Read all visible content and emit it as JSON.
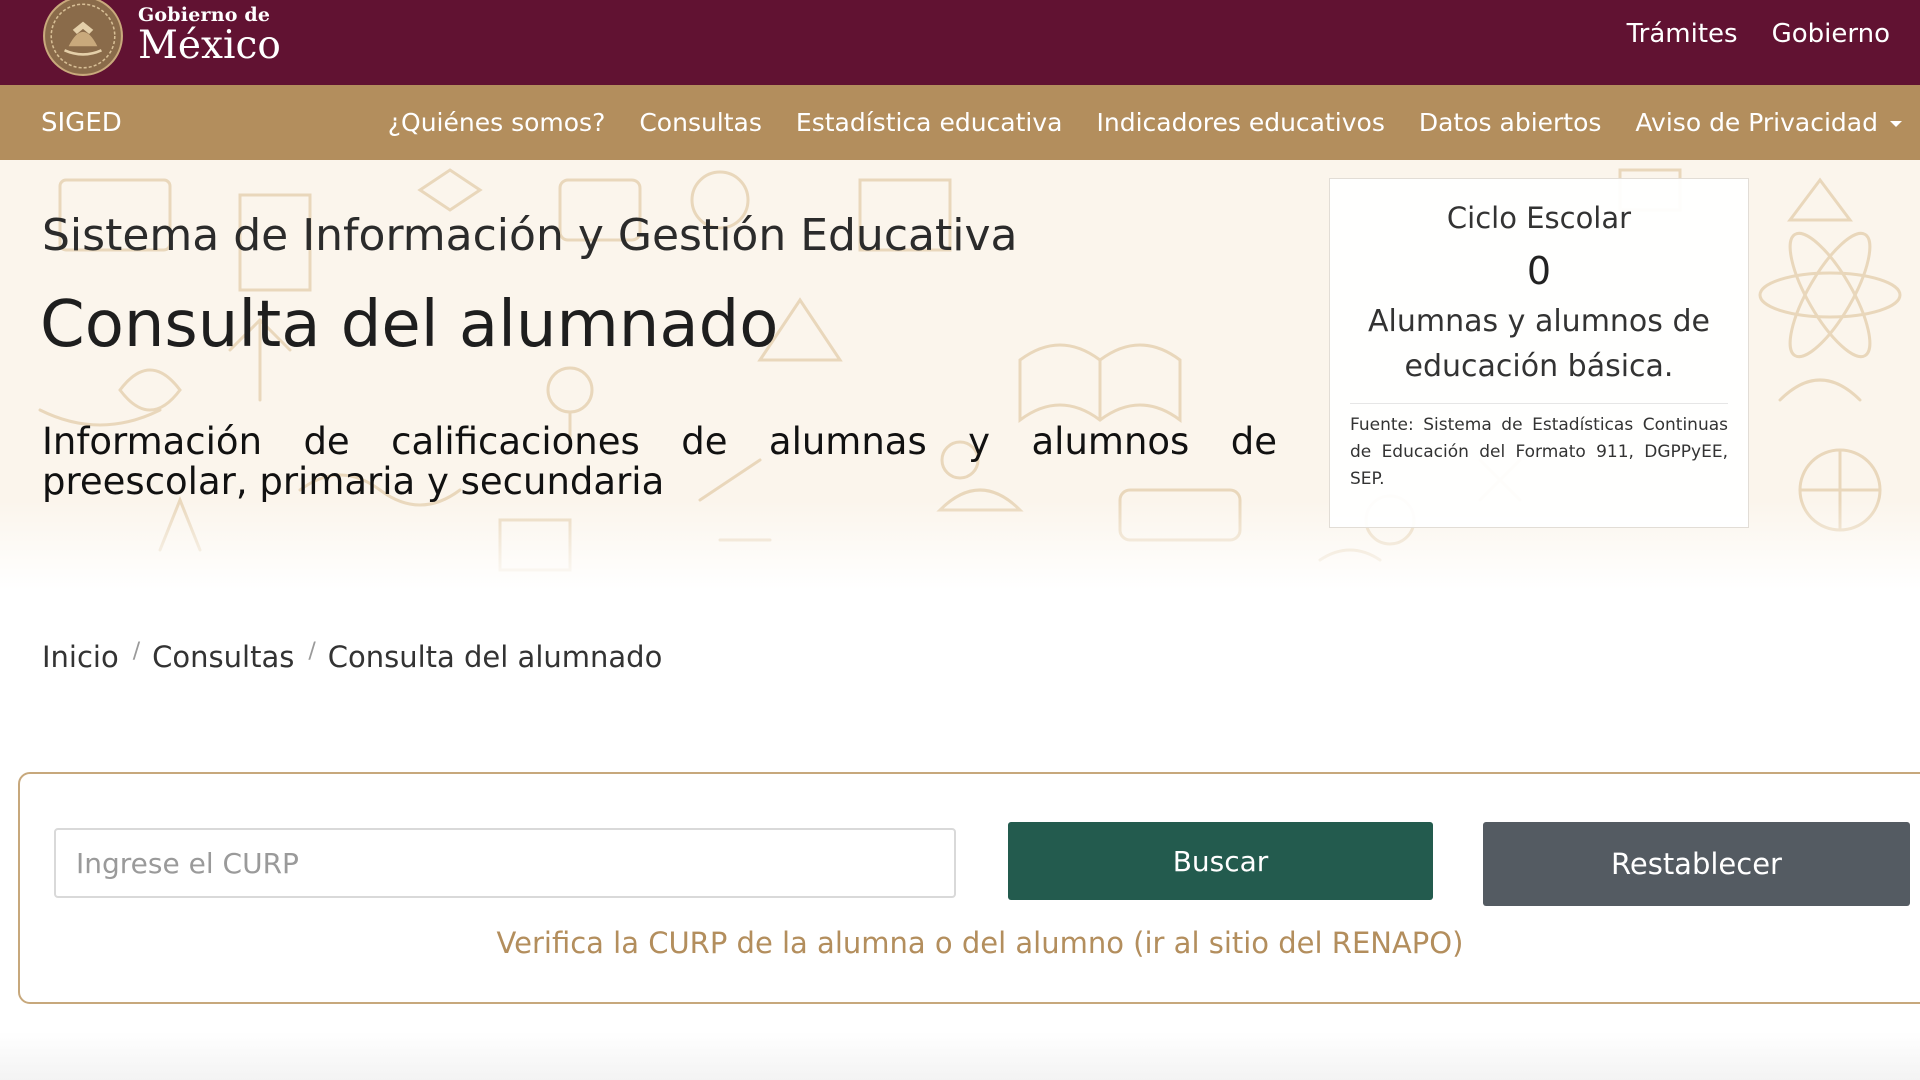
{
  "gov_header": {
    "wordmark_small": "Gobierno de",
    "wordmark_big": "México",
    "links": [
      "Trámites",
      "Gobierno"
    ]
  },
  "secondary_nav": {
    "brand": "SIGED",
    "items": [
      "¿Quiénes somos?",
      "Consultas",
      "Estadística educativa",
      "Indicadores educativos",
      "Datos abiertos",
      "Aviso de Privacidad"
    ]
  },
  "hero": {
    "subtitle": "Sistema de Información y Gestión Educativa",
    "title": "Consulta del alumnado",
    "description": "Información de calificaciones de alumnas y alumnos de preescolar, primaria y secundaria"
  },
  "stat_card": {
    "label": "Ciclo Escolar",
    "count": "0",
    "caption": "Alumnas y alumnos de educación básica.",
    "source": "Fuente: Sistema de Estadísticas Continuas de Educación del Formato 911, DGPPyEE, SEP."
  },
  "breadcrumb": {
    "items": [
      "Inicio",
      "Consultas",
      "Consulta del alumnado"
    ],
    "separator": "/"
  },
  "search": {
    "placeholder": "Ingrese el CURP",
    "value": "",
    "search_button": "Buscar",
    "reset_button": "Restablecer",
    "verify_link": "Verifica la CURP de la alumna o del alumno (ir al sitio del RENAPO)"
  },
  "colors": {
    "gov_bar": "#611232",
    "nav_bar": "#b38e5d",
    "search_button": "#235b4e",
    "reset_button": "#545b62",
    "link_gold": "#b38e5d"
  },
  "icons": {
    "seal": "coat-of-arms-icon",
    "dropdown": "caret-down-icon"
  }
}
